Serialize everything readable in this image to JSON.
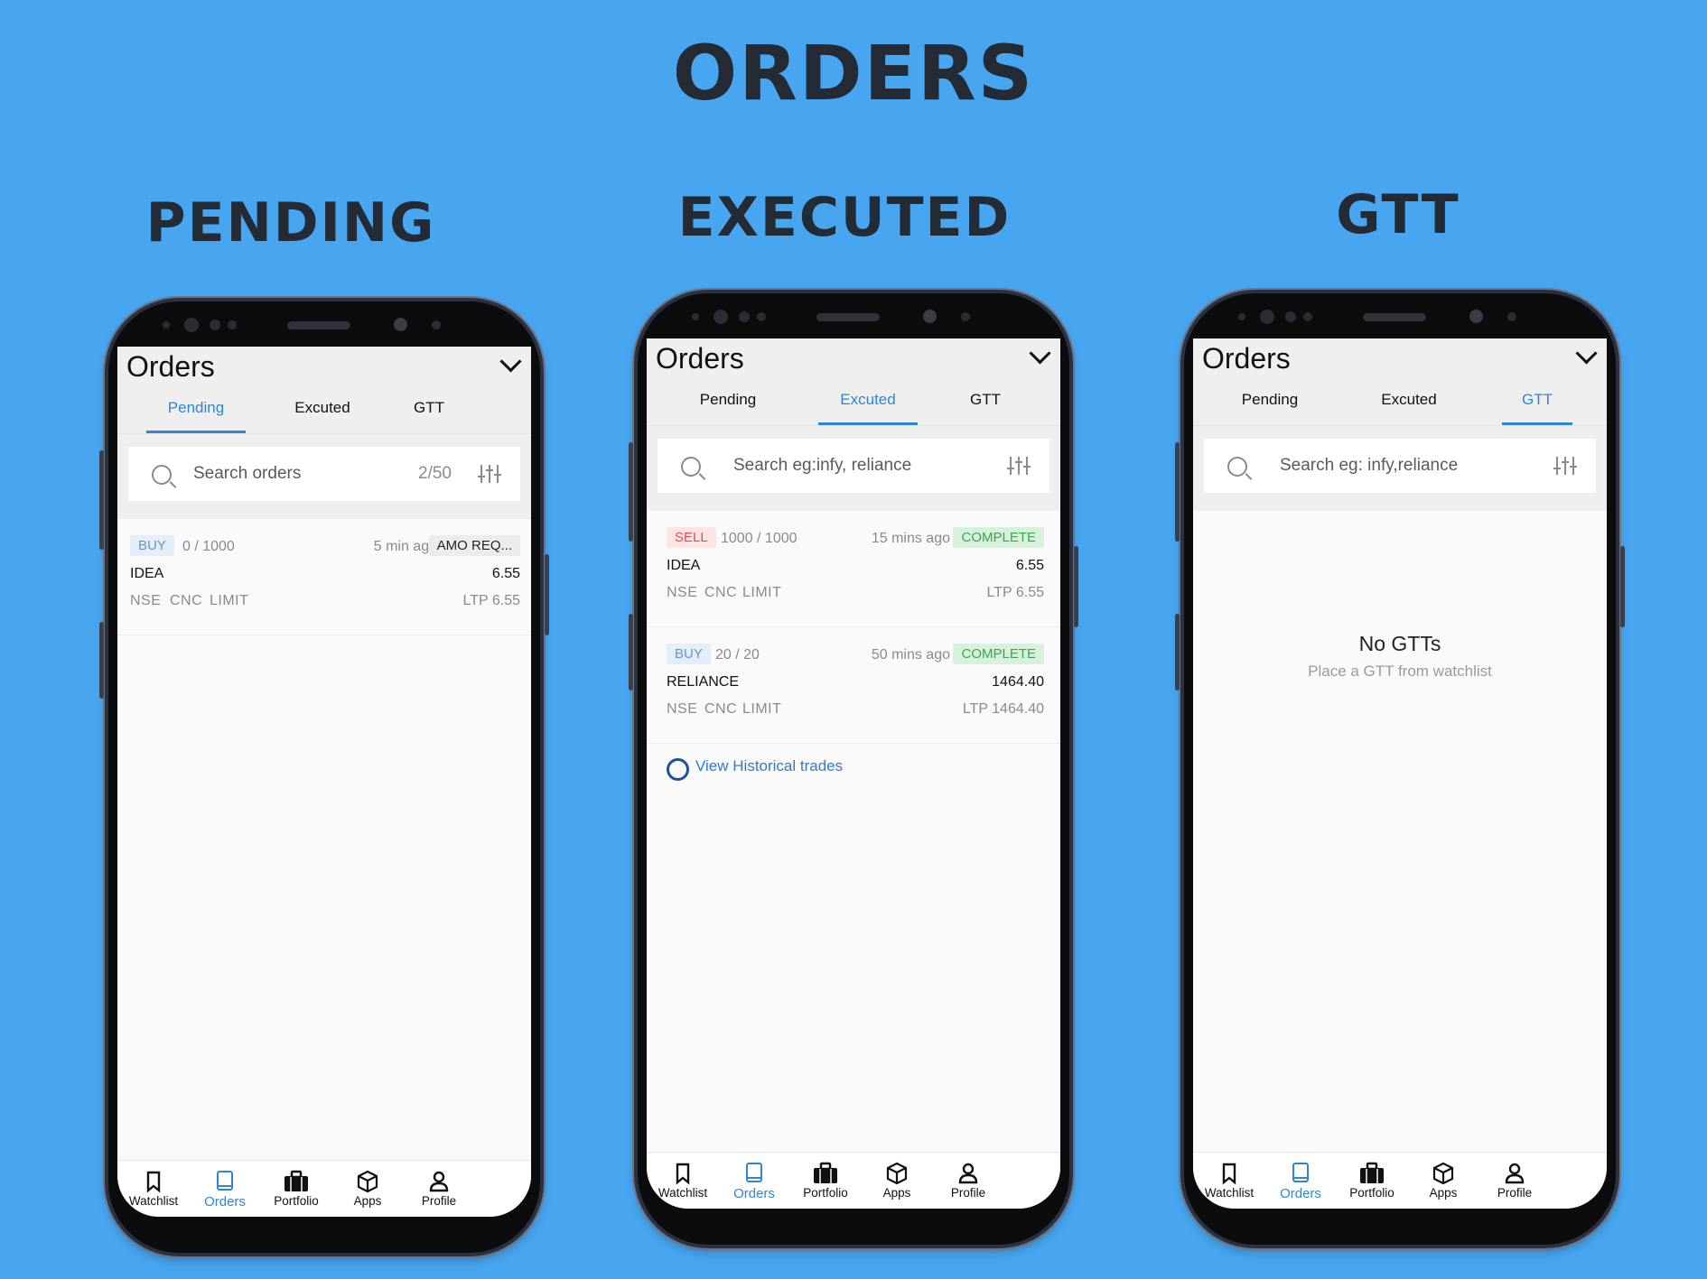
{
  "page_title": "ORDERS",
  "sections": {
    "pending": "PENDING",
    "executed": "EXECUTED",
    "gtt": "GTT"
  },
  "app_title": "Orders",
  "tabs": [
    "Pending",
    "Excuted",
    "GTT"
  ],
  "colors": {
    "background": "#48a6f1",
    "accent": "#2d86d6",
    "buy": "#6a95c4",
    "sell": "#e05050",
    "complete": "#3ea553"
  },
  "nav": [
    "Watchlist",
    "Orders",
    "Portfolio",
    "Apps",
    "Profile"
  ],
  "nav_icons": [
    "bookmark-icon",
    "book-icon",
    "briefcase-icon",
    "cube-icon",
    "user-icon"
  ],
  "pending_screen": {
    "search_placeholder": "Search orders",
    "count": "2/50",
    "order": {
      "side": "BUY",
      "qty": "0 / 1000",
      "time": "5 min ago",
      "status": "AMO REQ...",
      "symbol": "IDEA",
      "price": "6.55",
      "exchange": "NSE",
      "product": "CNC",
      "type": "LIMIT",
      "ltp": "LTP 6.55"
    }
  },
  "executed_screen": {
    "search_placeholder": "Search eg:infy, reliance",
    "orders": [
      {
        "side": "SELL",
        "qty": "1000 / 1000",
        "time": "15 mins ago",
        "status": "COMPLETE",
        "symbol": "IDEA",
        "price": "6.55",
        "exchange": "NSE",
        "product": "CNC",
        "type": "LIMIT",
        "ltp": "LTP 6.55"
      },
      {
        "side": "BUY",
        "qty": "20 / 20",
        "time": "50 mins ago",
        "status": "COMPLETE",
        "symbol": "RELIANCE",
        "price": "1464.40",
        "exchange": "NSE",
        "product": "CNC",
        "type": "LIMIT",
        "ltp": "LTP 1464.40"
      }
    ],
    "history_link": "View Historical trades"
  },
  "gtt_screen": {
    "search_placeholder": "Search eg: infy,reliance",
    "empty_title": "No GTTs",
    "empty_sub": "Place a GTT from watchlist"
  }
}
